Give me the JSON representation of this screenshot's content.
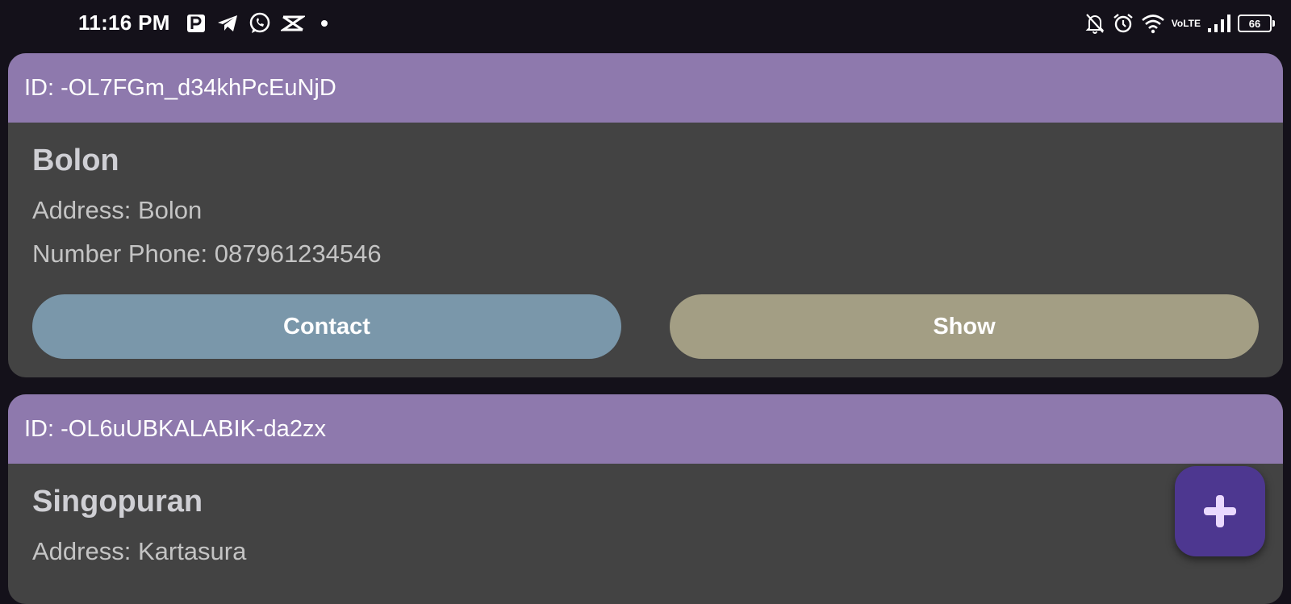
{
  "status_bar": {
    "time": "11:16 PM",
    "left_icons": [
      "parking-app-icon",
      "telegram-icon",
      "whatsapp-icon",
      "capcut-icon",
      "dot-icon"
    ],
    "right_icons": [
      "bell-off-icon",
      "alarm-icon",
      "wifi-icon",
      "volte-icon",
      "signal-icon",
      "battery-icon"
    ],
    "volte_top": "Vo",
    "volte_bottom": "LTE",
    "battery_level": "66"
  },
  "cards": [
    {
      "id_label": "ID: -OL7FGm_d34khPcEuNjD",
      "name": "Bolon",
      "address": "Address: Bolon",
      "phone": "Number Phone: 087961234546",
      "contact_label": "Contact",
      "show_label": "Show"
    },
    {
      "id_label": "ID: -OL6uUBKALABIK-da2zx",
      "name": "Singopuran",
      "address": "Address: Kartasura"
    }
  ],
  "fab": {
    "icon": "plus-icon"
  },
  "colors": {
    "background": "#14111a",
    "card_header": "#8e79ad",
    "card_body": "#434343",
    "contact_button": "#7a97aa",
    "show_button": "#a39e84",
    "fab": "#4d3790"
  }
}
